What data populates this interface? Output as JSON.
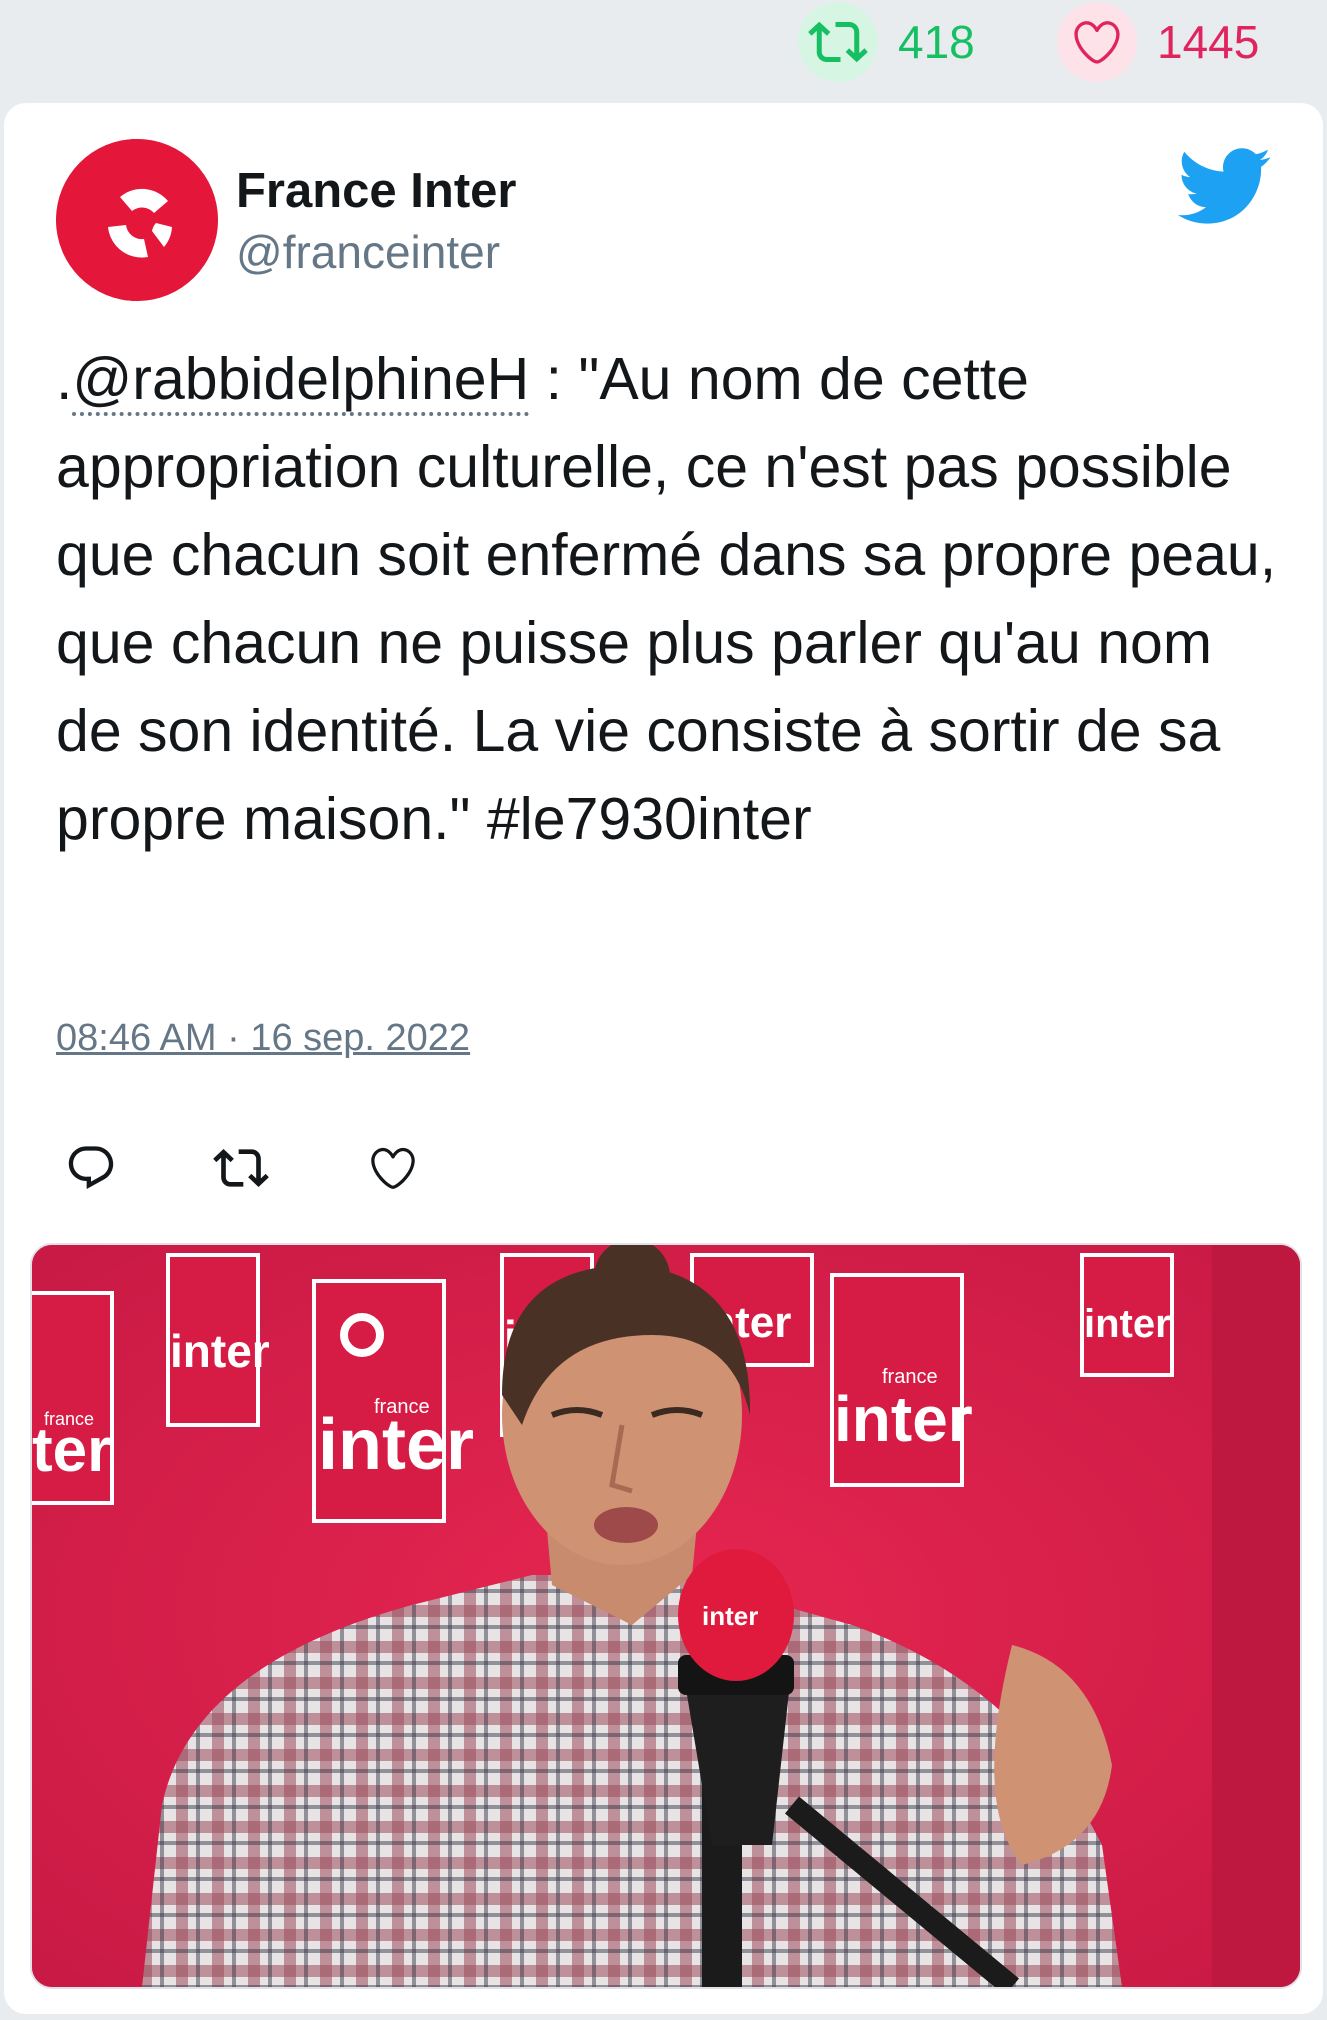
{
  "stats": {
    "retweets": "418",
    "likes": "1445",
    "retweet_icon": "retweet-icon",
    "like_icon": "heart-icon"
  },
  "author": {
    "name": "France Inter",
    "handle": "@franceinter"
  },
  "tweet": {
    "prefix": ".",
    "mention": "@rabbidelphineH",
    "body": " : \"Au nom de cette appropriation culturelle, ce n'est pas possible que chacun soit enfermé dans sa propre peau, que chacun ne puisse plus parler qu'au nom de son identité. La vie consiste à sortir de sa propre maison.\" #le7930inter",
    "timestamp": "08:46 AM · 16 sep. 2022"
  },
  "media": {
    "description_icon": "photo",
    "logo_label": "inter",
    "logo_small": "france"
  },
  "colors": {
    "retweet": "#17bf63",
    "like": "#e0245e",
    "brand": "#e4173a",
    "twitter_blue": "#1da1f2",
    "secondary_text": "#657786"
  }
}
